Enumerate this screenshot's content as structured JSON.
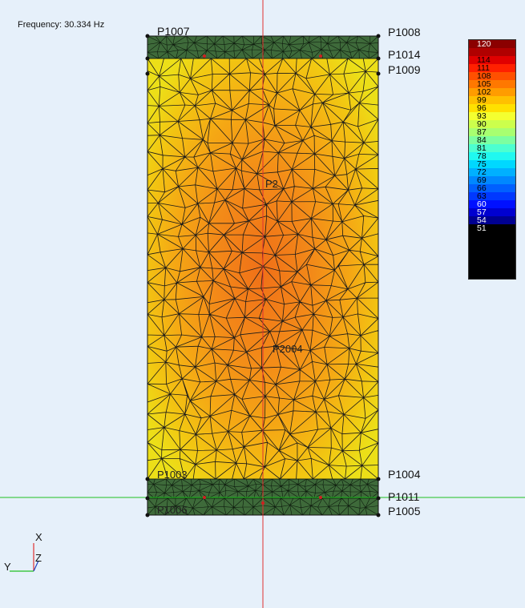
{
  "frequency_label": "Frequency: 30.334 Hz",
  "points": {
    "p1007": "P1007",
    "p1008": "P1008",
    "p1014": "P1014",
    "p1009": "P1009",
    "p1004": "P1004",
    "p1011": "P1011",
    "p1005": "P1005",
    "p1003": "P1003",
    "p1006": "P1006",
    "p2004": "P2004",
    "p2": "P2"
  },
  "axes": {
    "x": "X",
    "y": "Y",
    "z": "Z"
  },
  "legend": {
    "entries": [
      {
        "value": "120",
        "color": "#8b0000",
        "text": "#ffffff"
      },
      {
        "value": "",
        "color": "#b00000",
        "text": "#ffffff"
      },
      {
        "value": "114",
        "color": "#e00000",
        "text": "#000000"
      },
      {
        "value": "111",
        "color": "#ff2000",
        "text": "#000000"
      },
      {
        "value": "108",
        "color": "#ff5000",
        "text": "#000000"
      },
      {
        "value": "105",
        "color": "#ff7800",
        "text": "#000000"
      },
      {
        "value": "102",
        "color": "#ff9c00",
        "text": "#000000"
      },
      {
        "value": "99",
        "color": "#ffc000",
        "text": "#000000"
      },
      {
        "value": "96",
        "color": "#ffe000",
        "text": "#000000"
      },
      {
        "value": "93",
        "color": "#f4ff30",
        "text": "#000000"
      },
      {
        "value": "90",
        "color": "#ccff4c",
        "text": "#000000"
      },
      {
        "value": "87",
        "color": "#a8ff70",
        "text": "#000000"
      },
      {
        "value": "84",
        "color": "#7cffa0",
        "text": "#000000"
      },
      {
        "value": "81",
        "color": "#4cffd0",
        "text": "#000000"
      },
      {
        "value": "78",
        "color": "#20f8f0",
        "text": "#000000"
      },
      {
        "value": "75",
        "color": "#00d8ff",
        "text": "#000000"
      },
      {
        "value": "72",
        "color": "#00b0ff",
        "text": "#000000"
      },
      {
        "value": "69",
        "color": "#0088ff",
        "text": "#000000"
      },
      {
        "value": "66",
        "color": "#0060ff",
        "text": "#000000"
      },
      {
        "value": "63",
        "color": "#0038ff",
        "text": "#000000"
      },
      {
        "value": "60",
        "color": "#0010ff",
        "text": "#ffffff"
      },
      {
        "value": "57",
        "color": "#0000d0",
        "text": "#ffffff"
      },
      {
        "value": "54",
        "color": "#000090",
        "text": "#ffffff"
      },
      {
        "value": "51",
        "color": "#000000",
        "text": "#ffffff"
      },
      {
        "value": "",
        "color": "#000000",
        "text": "#ffffff"
      },
      {
        "value": "",
        "color": "#000000",
        "text": "#ffffff"
      },
      {
        "value": "",
        "color": "#000000",
        "text": "#ffffff"
      },
      {
        "value": "",
        "color": "#000000",
        "text": "#ffffff"
      },
      {
        "value": "",
        "color": "#000000",
        "text": "#ffffff"
      },
      {
        "value": "",
        "color": "#000000",
        "text": "#ffffff"
      }
    ]
  },
  "colors": {
    "background": "#e6f0fa",
    "band_green": "#3e6a3a",
    "field_yellow": "#f2dc10",
    "field_orange": "#f5a010",
    "hot_core": "#f07a18",
    "mesh_line": "#1a1a1a",
    "axis_red": "#e03030",
    "axis_green": "#20c020",
    "axis_blue": "#2040c0"
  }
}
